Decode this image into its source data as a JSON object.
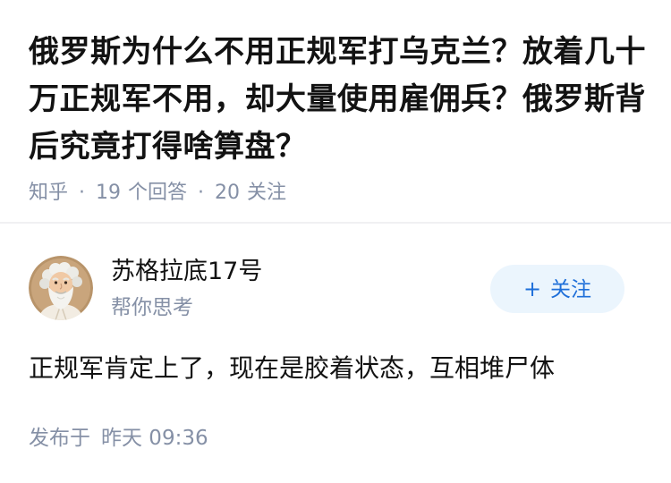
{
  "question": {
    "title": "俄罗斯为什么不用正规军打乌克兰？放着几十万正规军不用，却大量使用雇佣兵？俄罗斯背后究竟打得啥算盘？",
    "source": "知乎",
    "answer_count": "19",
    "answer_count_label": "个回答",
    "follower_count": "20",
    "follower_count_label": "关注"
  },
  "author": {
    "name": "苏格拉底17号",
    "bio": "帮你思考",
    "avatar_icon": "bearded-elder-avatar-icon",
    "follow_label": "关注",
    "follow_icon": "plus-icon"
  },
  "answer": {
    "text": "正规军肯定上了，现在是胶着状态，互相堆尸体",
    "published_label": "发布于",
    "published_time": "昨天 09:36"
  },
  "colors": {
    "text_primary": "#121212",
    "text_secondary": "#8590a6",
    "follow_bg": "#ebf5fd",
    "follow_text": "#1e6fd9"
  }
}
